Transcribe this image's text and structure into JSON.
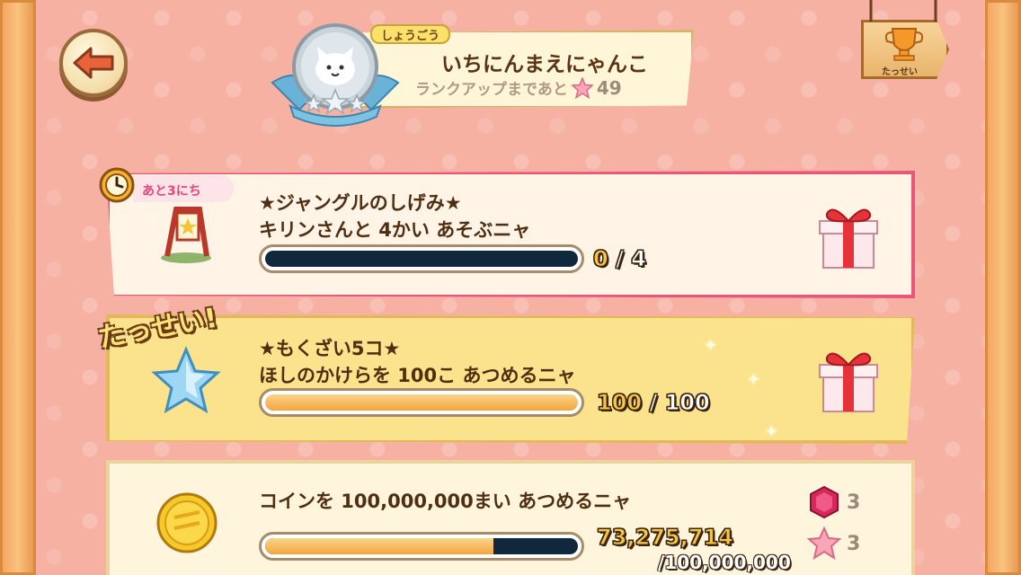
{
  "header": {
    "back_label": "",
    "rank_tag": "しょうごう",
    "rank_title": "いちにんまえにゃんこ",
    "rank_up_text": "ランクアップまであと",
    "rank_up_remaining": "49",
    "achievements_label": "たっせい"
  },
  "missions": [
    {
      "remaining": "あと3にち",
      "title_line1": "★ジャングルのしげみ★",
      "title_line2": "キリンさんと 4かい あそぶニャ",
      "current": "0",
      "separator": "/",
      "target": "4",
      "progress": 0,
      "status": "in-progress",
      "reward_icon": "gift-box-icon"
    },
    {
      "stamp": "たっせい!",
      "title_line1": "★もくざい5コ★",
      "title_line2": "ほしのかけらを 100こ あつめるニャ",
      "current": "100",
      "separator": "/",
      "target": "100",
      "progress": 1.0,
      "status": "completed",
      "reward_icon": "gift-box-icon"
    },
    {
      "title_line1": "コインを 100,000,000まい あつめるニャ",
      "current": "73,275,714",
      "target": "/100,000,000",
      "progress": 0.73,
      "status": "in-progress",
      "rewards": [
        {
          "icon": "ruby-gem-icon",
          "amount": "3"
        },
        {
          "icon": "pink-star-icon",
          "amount": "3"
        }
      ]
    }
  ],
  "colors": {
    "background": "#f6b1a3",
    "active_border": "#e8577a",
    "completed_card": "#fbe28c",
    "bar_empty": "#10283c",
    "bar_fill": "#f3a53e",
    "title_text": "#4f2e12"
  }
}
